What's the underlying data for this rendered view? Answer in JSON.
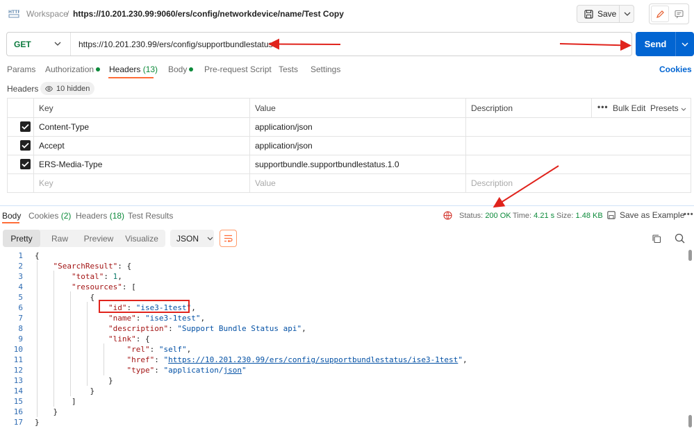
{
  "header": {
    "workspace": "Workspace",
    "separator": "/",
    "title": "https://10.201.230.99:9060/ers/config/networkdevice/name/Test Copy",
    "save_label": "Save"
  },
  "request": {
    "method": "GET",
    "url": "https://10.201.230.99/ers/config/supportbundlestatus",
    "send_label": "Send"
  },
  "request_tabs": [
    {
      "label": "Params"
    },
    {
      "label": "Authorization"
    },
    {
      "label": "Headers",
      "count": "(13)"
    },
    {
      "label": "Body"
    },
    {
      "label": "Pre-request Script"
    },
    {
      "label": "Tests"
    },
    {
      "label": "Settings"
    }
  ],
  "cookies_link": "Cookies",
  "headers_section": {
    "label": "Headers",
    "hidden_label": "10 hidden",
    "columns": {
      "key": "Key",
      "value": "Value",
      "description": "Description"
    },
    "bulk_edit": "Bulk Edit",
    "presets": "Presets",
    "rows": [
      {
        "key": "Content-Type",
        "value": "application/json"
      },
      {
        "key": "Accept",
        "value": "application/json"
      },
      {
        "key": "ERS-Media-Type",
        "value": "supportbundle.supportbundlestatus.1.0"
      }
    ],
    "placeholders": {
      "key": "Key",
      "value": "Value",
      "description": "Description"
    }
  },
  "response_tabs": [
    {
      "label": "Body"
    },
    {
      "label": "Cookies",
      "count": "(2)"
    },
    {
      "label": "Headers",
      "count": "(18)"
    },
    {
      "label": "Test Results"
    }
  ],
  "response_status": {
    "status_label": "Status:",
    "status_value": "200 OK",
    "time_label": "Time:",
    "time_value": "4.21 s",
    "size_label": "Size:",
    "size_value": "1.48 KB",
    "save_example": "Save as Example"
  },
  "view_options": [
    "Pretty",
    "Raw",
    "Preview",
    "Visualize"
  ],
  "format": "JSON",
  "code_lines": [
    "1",
    "2",
    "3",
    "4",
    "5",
    "6",
    "7",
    "8",
    "9",
    "10",
    "11",
    "12",
    "13",
    "14",
    "15",
    "16",
    "17"
  ],
  "json_body": {
    "SearchResult": "\"SearchResult\"",
    "total_key": "\"total\"",
    "total_val": "1",
    "resources_key": "\"resources\"",
    "id_key": "\"id\"",
    "id_val": "\"ise3-1test\"",
    "name_key": "\"name\"",
    "name_val": "\"ise3-1test\"",
    "description_key": "\"description\"",
    "description_val": "\"Support Bundle Status api\"",
    "link_key": "\"link\"",
    "rel_key": "\"rel\"",
    "rel_val": "\"self\"",
    "href_key": "\"href\"",
    "href_val": "https://10.201.230.99/ers/config/supportbundlestatus/ise3-1test",
    "type_key": "\"type\"",
    "type_val_a": "\"application/",
    "type_val_b": "json",
    "type_val_c": "\""
  },
  "colors": {
    "accent": "#ff6c37",
    "send": "#0265d2",
    "method": "#0c7a3e",
    "status_ok": "#0c8a3a",
    "annotation": "#e0231c"
  }
}
